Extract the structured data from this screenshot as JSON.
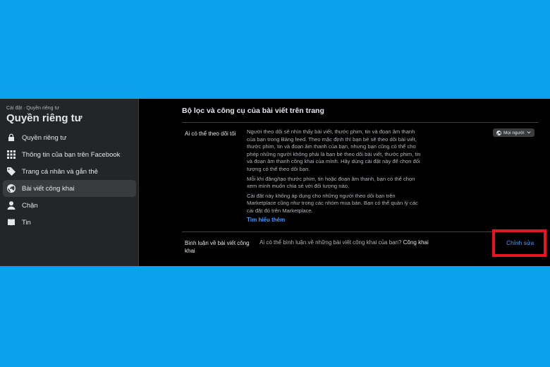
{
  "sidebar": {
    "breadcrumb": "Cài đặt · Quyền riêng tư",
    "title": "Quyền riêng tư",
    "items": [
      {
        "label": "Quyền riêng tư",
        "icon": "lock-icon"
      },
      {
        "label": "Thông tin của bạn trên Facebook",
        "icon": "grid-icon"
      },
      {
        "label": "Trang cá nhân và gắn thẻ",
        "icon": "tag-icon"
      },
      {
        "label": "Bài viết công khai",
        "icon": "globe-icon",
        "active": true
      },
      {
        "label": "Chặn",
        "icon": "user-block-icon"
      },
      {
        "label": "Tin",
        "icon": "book-icon"
      }
    ]
  },
  "main": {
    "section_title": "Bộ lọc và công cụ của bài viết trên trang",
    "followers": {
      "label": "Ai có thể theo dõi tôi",
      "audience_button": "Mọi người",
      "paragraphs": [
        "Người theo dõi sẽ nhìn thấy bài viết, thước phim, tin và đoạn âm thanh của bạn trong Bảng feed. Theo mặc định thì bạn bè sẽ theo dõi bài viết, thước phim, tin và đoạn âm thanh của bạn, nhưng bạn cũng có thể cho phép những người không phải là bạn bè theo dõi bài viết, thước phim, tin và đoạn âm thanh công khai của mình. Hãy dùng cài đặt này để chọn đối tượng có thể theo dõi bạn.",
        "Mỗi khi đăng/tạo thước phim, tin hoặc đoạn âm thanh, bạn có thể chọn xem mình muốn chia sẻ với đối tượng nào.",
        "Cài đặt này không áp dụng cho những người theo dõi bạn trên Marketplace cũng như trong các nhóm mua bán. Bạn có thể quản lý các cài đặt đó trên Marketplace."
      ],
      "learn_more": "Tìm hiểu thêm"
    },
    "comments": {
      "label": "Bình luận về bài viết công khai",
      "question": "Ai có thể bình luận về những bài viết công khai của bạn?",
      "value": "Công khai",
      "edit": "Chỉnh sửa"
    }
  },
  "colors": {
    "background": "#0aa2ef",
    "highlight_box": "#e8141f",
    "link": "#4599ff"
  }
}
